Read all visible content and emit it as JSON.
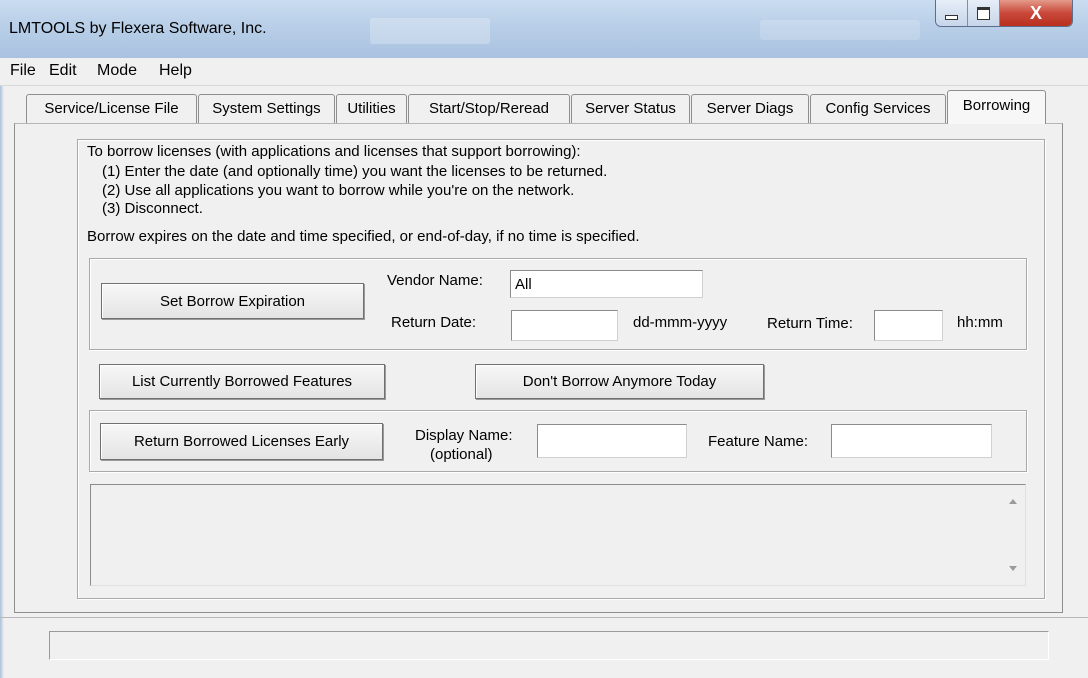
{
  "window": {
    "title": "LMTOOLS by Flexera Software, Inc.",
    "minimize_icon": "minimize-icon",
    "maximize_icon": "maximize-icon",
    "close_glyph": "X"
  },
  "menu": [
    "File",
    "Edit",
    "Mode",
    "Help"
  ],
  "tabs": [
    {
      "label": "Service/License File"
    },
    {
      "label": "System Settings"
    },
    {
      "label": "Utilities"
    },
    {
      "label": "Start/Stop/Reread"
    },
    {
      "label": "Server Status"
    },
    {
      "label": "Server Diags"
    },
    {
      "label": "Config Services"
    },
    {
      "label": "Borrowing",
      "active": true
    }
  ],
  "borrowing": {
    "intro": "To borrow licenses (with applications and licenses that support borrowing):",
    "steps": [
      "(1) Enter the date (and optionally time) you want the licenses to be returned.",
      "(2) Use all applications you want to borrow while you're on the network.",
      "(3) Disconnect."
    ],
    "expires_note": "Borrow expires on the date and time specified, or end-of-day, if no time is specified.",
    "set_expiration_button": "Set Borrow Expiration",
    "vendor_name_label": "Vendor Name:",
    "vendor_name_value": "All",
    "return_date_label": "Return Date:",
    "return_date_value": "",
    "date_format_hint": "dd-mmm-yyyy",
    "return_time_label": "Return Time:",
    "return_time_value": "",
    "time_format_hint": "hh:mm",
    "list_borrowed_button": "List Currently Borrowed Features",
    "dont_borrow_button": "Don't Borrow Anymore Today",
    "return_early_button": "Return Borrowed Licenses Early",
    "display_name_label": "Display Name:",
    "display_name_optional": "(optional)",
    "display_name_value": "",
    "feature_name_label": "Feature Name:",
    "feature_name_value": "",
    "output_text": ""
  },
  "status_text": ""
}
